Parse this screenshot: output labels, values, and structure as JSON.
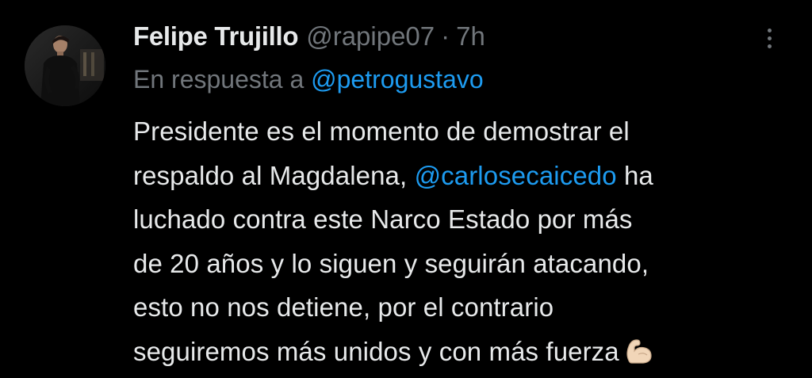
{
  "tweet": {
    "author": {
      "name": "Felipe Trujillo",
      "handle": "@rapipe07",
      "separator": "·",
      "time": "7h",
      "avatar_icon": "profile-photo"
    },
    "reply": {
      "prefix": "En respuesta a",
      "mention": "@petrogustavo"
    },
    "text_lines": {
      "l1": "Presidente es el momento de demostrar el",
      "l2_before": "respaldo al Magdalena,",
      "l2_mention": "@carlosecaicedo",
      "l2_after": "ha",
      "l3": "luchado contra este Narco Estado por más",
      "l4": "de 20 años y lo siguen y seguirán atacando,",
      "l5": "esto no nos detiene, por el contrario",
      "l6": "seguiremos más unidos y con más fuerza"
    },
    "emoji_name": "flexed-biceps-icon",
    "more_icon": "more-vertical-icon"
  },
  "colors": {
    "background": "#000000",
    "text": "#e7e9ea",
    "secondary": "#71767b",
    "link": "#1d9bf0"
  }
}
